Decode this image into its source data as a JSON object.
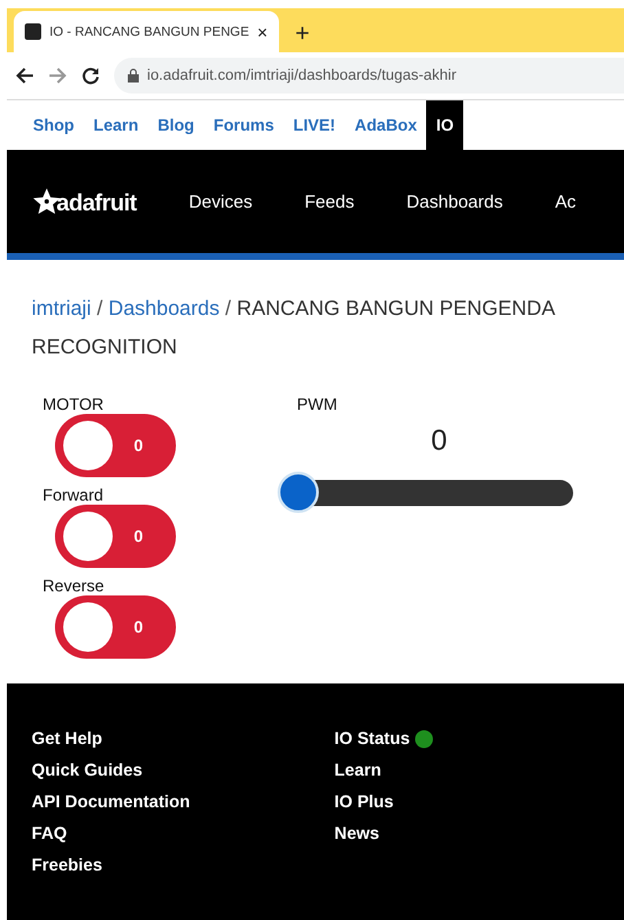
{
  "browser": {
    "tab_title": "IO - RANCANG BANGUN PENGE",
    "new_tab": "+",
    "close": "×",
    "url": "io.adafruit.com/imtriaji/dashboards/tugas-akhir"
  },
  "site_nav": [
    {
      "label": "Shop",
      "selected": false
    },
    {
      "label": "Learn",
      "selected": false
    },
    {
      "label": "Blog",
      "selected": false
    },
    {
      "label": "Forums",
      "selected": false
    },
    {
      "label": "LIVE!",
      "selected": false
    },
    {
      "label": "AdaBox",
      "selected": false
    },
    {
      "label": "IO",
      "selected": true
    }
  ],
  "header": {
    "logo": "adafruit",
    "nav": [
      "Devices",
      "Feeds",
      "Dashboards",
      "Ac"
    ]
  },
  "breadcrumb": {
    "user": "imtriaji",
    "separator_1": "/",
    "section": "Dashboards",
    "separator_2": "/",
    "title_line_1": "RANCANG BANGUN PENGENDA",
    "title_line_2": "RECOGNITION"
  },
  "toggles": [
    {
      "label": "MOTOR",
      "value": "0",
      "on": false
    },
    {
      "label": "Forward",
      "value": "0",
      "on": false
    },
    {
      "label": "Reverse",
      "value": "0",
      "on": false
    }
  ],
  "slider": {
    "label": "PWM",
    "value": "0",
    "level": 0
  },
  "footer": {
    "column_1": [
      {
        "label": "Get Help"
      },
      {
        "label": "Quick Guides"
      },
      {
        "label": "API Documentation"
      },
      {
        "label": "FAQ"
      },
      {
        "label": "Freebies"
      }
    ],
    "column_2": [
      {
        "label": "IO Status",
        "color": "#1e8f1e"
      },
      {
        "label": "Learn"
      },
      {
        "label": "IO Plus"
      },
      {
        "label": "News"
      }
    ]
  }
}
